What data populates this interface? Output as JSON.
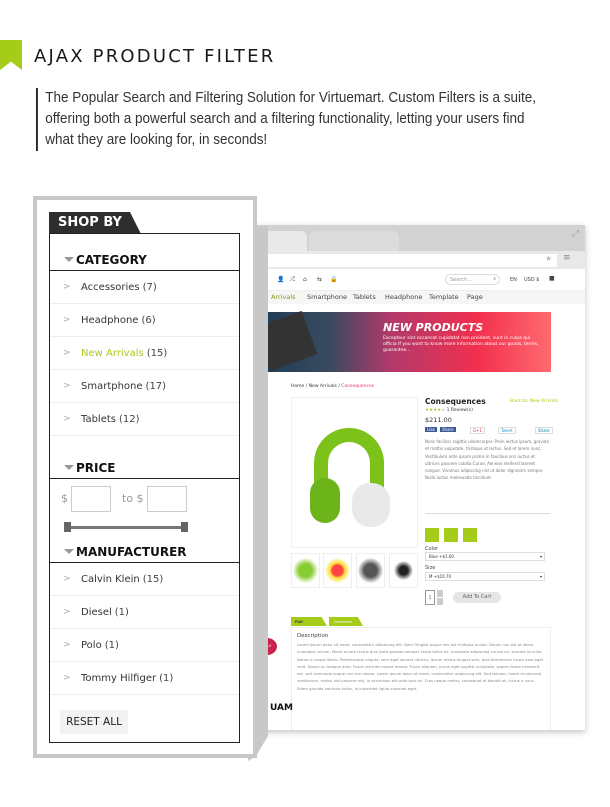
{
  "header": {
    "title": "AJAX PRODUCT FILTER",
    "description": "The Popular Search and Filtering Solution for Virtuemart. Custom Filters is a suite, offering both a powerful search and a filtering functionality, letting your users find what they are looking for, in seconds!",
    "accent": "#a6cc1a"
  },
  "filter": {
    "tab": "SHOP BY",
    "category": {
      "title": "CATEGORY",
      "items": [
        {
          "label": "Accessories",
          "count": "(7)"
        },
        {
          "label": "Headphone",
          "count": "(6)"
        },
        {
          "label": "New Arrivals",
          "count": "(15)",
          "active": true
        },
        {
          "label": "Smartphone",
          "count": "(17)"
        },
        {
          "label": "Tablets",
          "count": "(12)"
        }
      ]
    },
    "price": {
      "title": "PRICE",
      "currency": "$",
      "to": "to",
      "min_value": "",
      "max_value": ""
    },
    "manufacturer": {
      "title": "MANUFACTURER",
      "items": [
        {
          "label": "Calvin Klein",
          "count": "(15)"
        },
        {
          "label": "Diesel",
          "count": "(1)"
        },
        {
          "label": "Polo",
          "count": "(1)"
        },
        {
          "label": "Tommy Hilfiger",
          "count": "(1)"
        }
      ]
    },
    "reset": "RESET ALL"
  },
  "shop": {
    "search_placeholder": "Search...",
    "lang": "EN",
    "currency": "USD $",
    "nav": [
      "Arrivals",
      "Smartphone",
      "Tablets",
      "Headphone",
      "Template",
      "Page"
    ],
    "banner": {
      "title": "NEW PRODUCTS",
      "text": "Excepteur sint occaecat cupidatat non proident, sunt in culpa qui officia If you want to know more information about our goods, terms, guarantee..."
    },
    "breadcrumb": [
      "Home",
      "New Arrivals",
      "Consequences"
    ],
    "product": {
      "name": "Consequences",
      "back": "Back to: New Arrivals",
      "reviews": "1 Review(s)",
      "price": "$211.00",
      "rating": 4,
      "social": [
        "Like",
        "Share",
        "G+1",
        "Tweet",
        "Share"
      ],
      "desc": "Nunc facilisis sagittis ullamcorper. Proin lectus ipsum, gravida et mattis vulputate, tristique ut lectus. Sed et lorem nunc. Vestibulum ante ipsum primis in faucibus orci luctus et ultrices posuere cubilia Curae; Aenean eleifend laoreet congue. Vivamus adipiscing nisl ut dolor dignissim semper. Nulla luctus malesuada tincidunt.",
      "color_label": "Color",
      "color_value": "Blue +$1.60",
      "size_label": "Size",
      "size_value": "M +$10.70",
      "qty": "1",
      "add_to_cart": "Add To Cart"
    },
    "tabs": [
      "Full Description",
      "Overview"
    ],
    "desc_title": "Description",
    "desc_body": "Lorem ipsum dolor sit amet, consectetur adipiscing elit. Nam fringilla augue nec est tristique auctor. Donec non est at libero vulputate rutrum. Morbi ornare lectus quis justo gravida semper. Nulla tellus mi, vulputate adipiscing cursus eu, suscipit id nulla. Donec a neque libero. Pellentesque aliquet, sem eget laoreet ultrices, ipsum metus feugiat sem, quis fermentum turpis eros eget velit. Donec ac tempus ante. Fusce ultricies massa massa. Fusce aliquam, purus eget sagittis vulputate, sapien libero hendrerit est, sed commodo augue nisi non neque. Lorem ipsum dolor sit amet, consectetur adipiscing elit. Sed tempor, lorem et placerat vestibulum, metus nisi posuere nisl, in accumsan elit odio quis mi. Cras neque metus, consequat et blandit et, luctus a nunc. Etiam gravida vehicula tellus, in imperdiet ligula euismod eget.",
    "sale": "SALE",
    "side_text": "UAM"
  }
}
